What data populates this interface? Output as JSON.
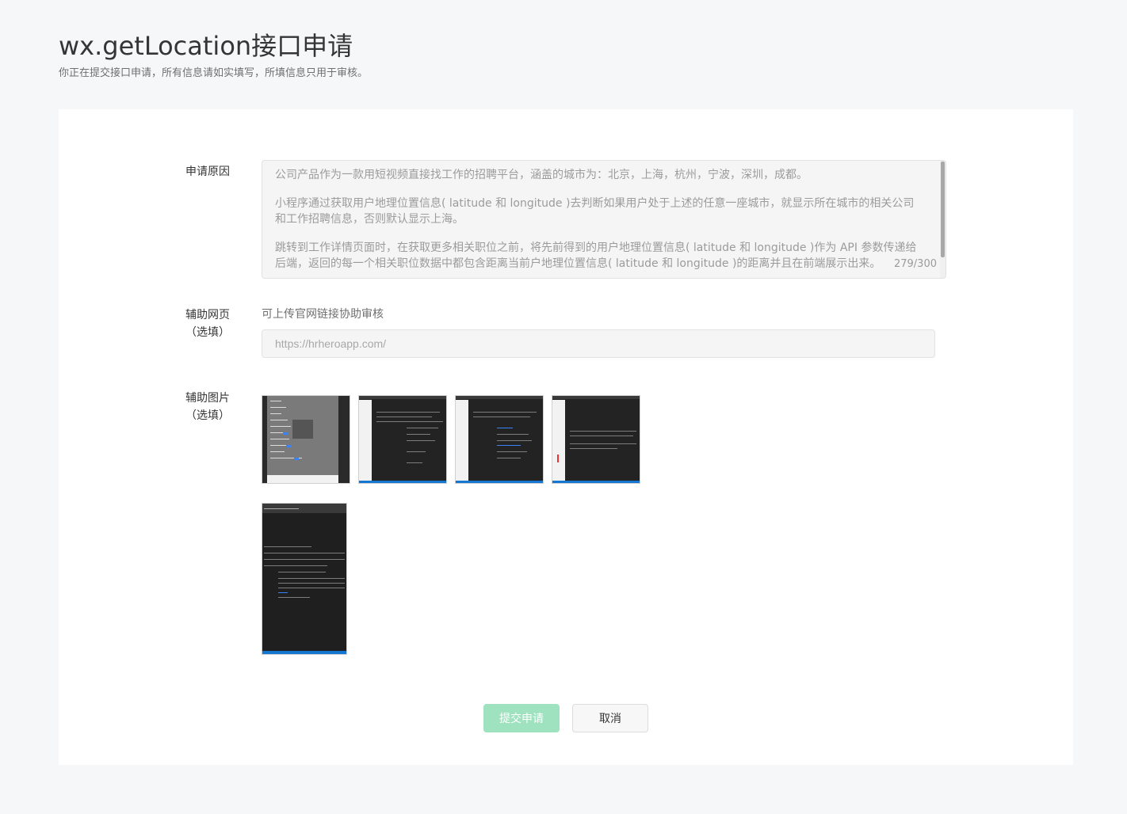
{
  "header": {
    "title": "wx.getLocation接口申请",
    "description": "你正在提交接口申请，所有信息请如实填写，所填信息只用于审核。"
  },
  "form": {
    "reason": {
      "label": "申请原因",
      "paragraphs": [
        "公司产品作为一款用短视频直接找工作的招聘平台，涵盖的城市为：北京，上海，杭州，宁波，深圳，成都。",
        "小程序通过获取用户地理位置信息( latitude 和 longitude )去判断如果用户处于上述的任意一座城市，就显示所在城市的相关公司和工作招聘信息，否则默认显示上海。",
        "跳转到工作详情页面时，在获取更多相关职位之前，将先前得到的用户地理位置信息( latitude 和 longitude )作为 API 参数传递给后端，返回的每一个相关职位数据中都包含距离当前户地理位置信息( latitude 和 longitude )的距离并且在前端展示出来。"
      ],
      "counter": "279/300"
    },
    "webpage": {
      "label_line1": "辅助网页",
      "label_line2": "（选填）",
      "hint": "可上传官网链接协助审核",
      "placeholder": "https://hrheroapp.com/"
    },
    "images": {
      "label_line1": "辅助图片",
      "label_line2": "（选填）",
      "items": [
        "image-1",
        "image-2",
        "image-3",
        "image-4",
        "image-5"
      ]
    }
  },
  "actions": {
    "submit": "提交申请",
    "cancel": "取消"
  },
  "colors": {
    "primary_disabled": "#9ee2bf",
    "background": "#f6f7f9",
    "accent_blue": "#1677d2"
  }
}
